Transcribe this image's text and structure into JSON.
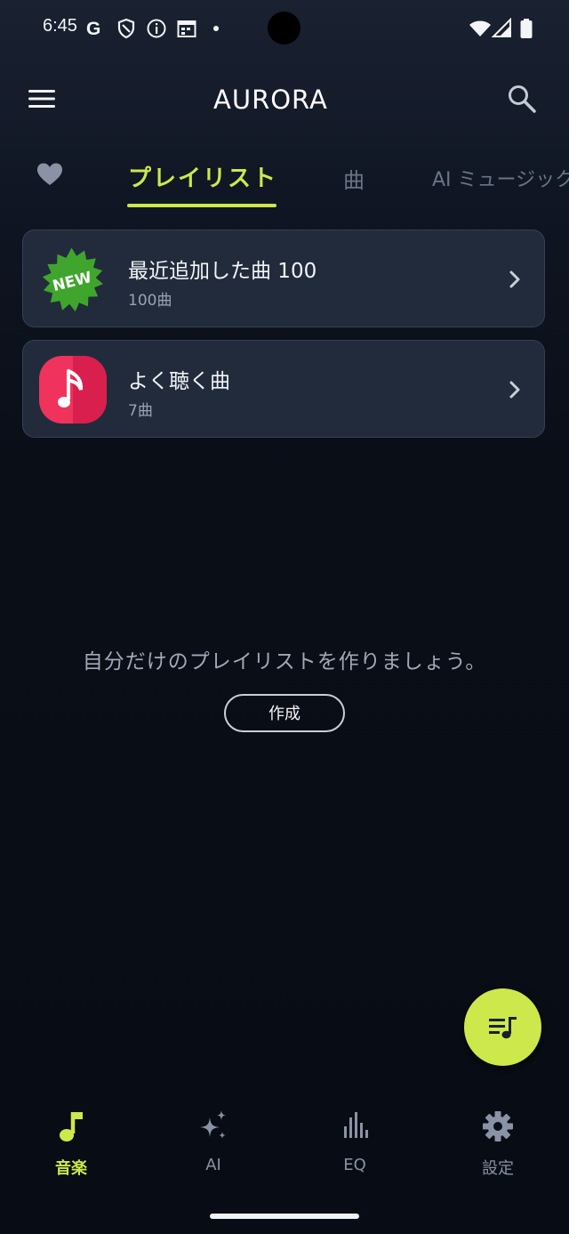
{
  "status_bar": {
    "time": "6:45",
    "icons": [
      "google-g-icon",
      "shield-icon",
      "info-icon",
      "calendar-icon",
      "dot-icon",
      "wifi-icon",
      "signal-icon",
      "battery-icon"
    ]
  },
  "app_bar": {
    "logo_text": "AURORA",
    "menu_icon": "hamburger-menu-icon",
    "search_icon": "search-icon"
  },
  "tabs": {
    "favorites_icon": "heart-icon",
    "items": [
      {
        "label": "プレイリスト",
        "active": true
      },
      {
        "label": "曲",
        "active": false
      },
      {
        "label": "AI ミュージック",
        "active": false
      }
    ]
  },
  "playlists": [
    {
      "badge": "NEW",
      "title": "最近追加した曲 100",
      "count": "100曲",
      "icon": "new-starburst-icon"
    },
    {
      "title": "よく聴く曲",
      "count": "7曲",
      "icon": "music-note-app-icon"
    }
  ],
  "empty_state": {
    "message": "自分だけのプレイリストを作りましょう。",
    "create_label": "作成"
  },
  "fab": {
    "icon": "playlist-add-icon"
  },
  "bottom_nav": [
    {
      "label": "音楽",
      "icon": "music-note-icon",
      "active": true
    },
    {
      "label": "AI",
      "icon": "sparkle-icon",
      "active": false
    },
    {
      "label": "EQ",
      "icon": "equalizer-icon",
      "active": false
    },
    {
      "label": "設定",
      "icon": "gear-icon",
      "active": false
    }
  ],
  "colors": {
    "accent": "#cde84a",
    "background": "#0a0e17",
    "card": "#222b3c",
    "new_badge": "#3fa52d",
    "music_app_icon": "#f0335c"
  }
}
